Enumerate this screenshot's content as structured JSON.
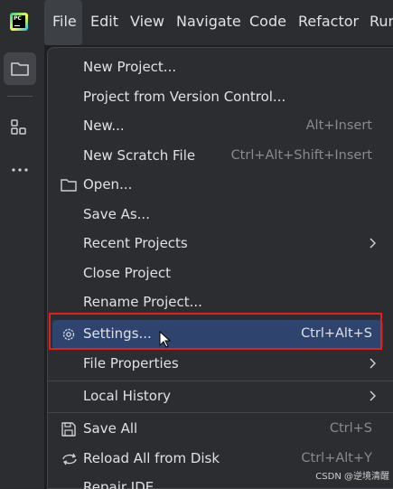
{
  "app": {
    "logo_text": "PC"
  },
  "menubar": {
    "items": [
      {
        "label": "File"
      },
      {
        "label": "Edit"
      },
      {
        "label": "View"
      },
      {
        "label": "Navigate"
      },
      {
        "label": "Code"
      },
      {
        "label": "Refactor"
      },
      {
        "label": "Run"
      }
    ]
  },
  "sidebar": {
    "items": [
      "folder-icon",
      "structure-icon",
      "more-icon"
    ]
  },
  "file_menu": {
    "items": [
      {
        "label": "New Project...",
        "shortcut": ""
      },
      {
        "label": "Project from Version Control...",
        "shortcut": ""
      },
      {
        "label": "New...",
        "shortcut": "Alt+Insert"
      },
      {
        "label": "New Scratch File",
        "shortcut": "Ctrl+Alt+Shift+Insert"
      },
      {
        "label": "Open...",
        "shortcut": "",
        "icon": "folder-icon"
      },
      {
        "label": "Save As...",
        "shortcut": ""
      },
      {
        "label": "Recent Projects",
        "shortcut": "",
        "submenu": true
      },
      {
        "label": "Close Project",
        "shortcut": ""
      },
      {
        "label": "Rename Project...",
        "shortcut": ""
      },
      {
        "label": "Settings...",
        "shortcut": "Ctrl+Alt+S",
        "icon": "gear-icon",
        "highlighted": true
      },
      {
        "label": "File Properties",
        "shortcut": "",
        "submenu": true
      },
      {
        "label": "Local History",
        "shortcut": "",
        "submenu": true
      },
      {
        "label": "Save All",
        "shortcut": "Ctrl+S",
        "icon": "save-icon"
      },
      {
        "label": "Reload All from Disk",
        "shortcut": "Ctrl+Alt+Y",
        "icon": "reload-icon"
      },
      {
        "label": "Repair IDE",
        "shortcut": ""
      }
    ]
  },
  "watermark": "CSDN @逆境清醒",
  "colors": {
    "highlight": "#2e436e",
    "annotation_box": "#e0201b",
    "background": "#2b2d30"
  }
}
